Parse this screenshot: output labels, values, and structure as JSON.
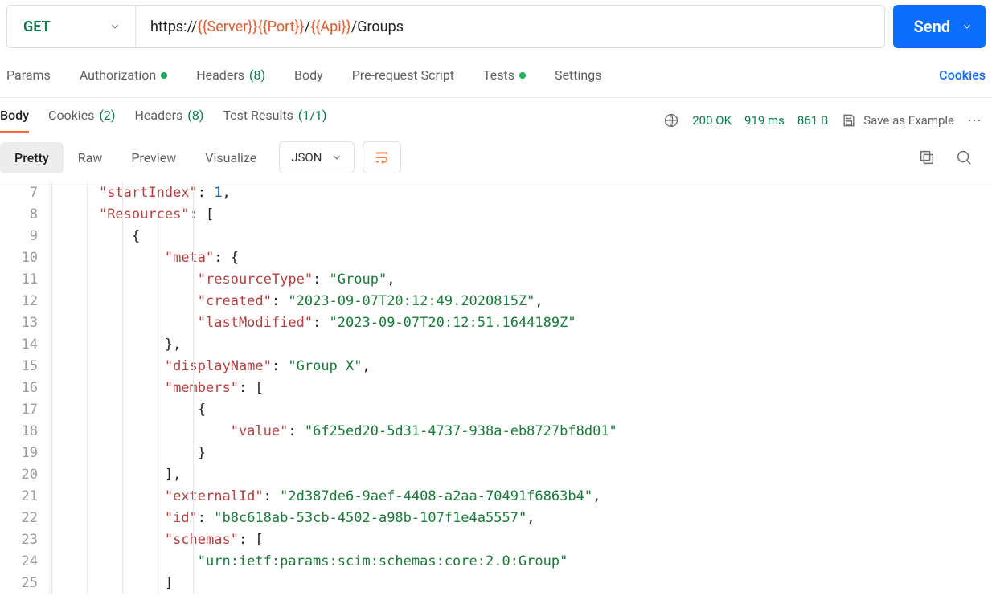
{
  "request": {
    "method": "GET",
    "url_prefix": "https://",
    "url_tmpl_server": "{{Server}}",
    "url_tmpl_port": "{{Port}}",
    "url_sep1": "/",
    "url_tmpl_api": "{{Api}}",
    "url_suffix": "/Groups",
    "send_label": "Send"
  },
  "req_tabs": {
    "params": "Params",
    "authorization": "Authorization",
    "headers": "Headers",
    "headers_count": "(8)",
    "body": "Body",
    "prerequest": "Pre-request Script",
    "tests": "Tests",
    "settings": "Settings",
    "cookies": "Cookies"
  },
  "resp_tabs": {
    "body": "Body",
    "cookies": "Cookies",
    "cookies_count": "(2)",
    "headers": "Headers",
    "headers_count": "(8)",
    "test_results": "Test Results",
    "test_results_count": "(1/1)"
  },
  "resp_meta": {
    "status": "200 OK",
    "time": "919 ms",
    "size": "861 B",
    "save_example": "Save as Example"
  },
  "view_tabs": {
    "pretty": "Pretty",
    "raw": "Raw",
    "preview": "Preview",
    "visualize": "Visualize",
    "format": "JSON"
  },
  "code": {
    "first_line_number": 7,
    "lines": [
      {
        "indent": 1,
        "tokens": [
          [
            "key",
            "\"startIndex\""
          ],
          [
            "punct",
            ": "
          ],
          [
            "num",
            "1"
          ],
          [
            "punct",
            ","
          ]
        ]
      },
      {
        "indent": 1,
        "tokens": [
          [
            "key",
            "\"Resources\""
          ],
          [
            "punct",
            ": ["
          ]
        ]
      },
      {
        "indent": 2,
        "tokens": [
          [
            "punct",
            "{"
          ]
        ]
      },
      {
        "indent": 3,
        "tokens": [
          [
            "key",
            "\"meta\""
          ],
          [
            "punct",
            ": {"
          ]
        ]
      },
      {
        "indent": 4,
        "tokens": [
          [
            "key",
            "\"resourceType\""
          ],
          [
            "punct",
            ": "
          ],
          [
            "str",
            "\"Group\""
          ],
          [
            "punct",
            ","
          ]
        ]
      },
      {
        "indent": 4,
        "tokens": [
          [
            "key",
            "\"created\""
          ],
          [
            "punct",
            ": "
          ],
          [
            "str",
            "\"2023-09-07T20:12:49.2020815Z\""
          ],
          [
            "punct",
            ","
          ]
        ]
      },
      {
        "indent": 4,
        "tokens": [
          [
            "key",
            "\"lastModified\""
          ],
          [
            "punct",
            ": "
          ],
          [
            "str",
            "\"2023-09-07T20:12:51.1644189Z\""
          ]
        ]
      },
      {
        "indent": 3,
        "tokens": [
          [
            "punct",
            "},"
          ]
        ]
      },
      {
        "indent": 3,
        "tokens": [
          [
            "key",
            "\"displayName\""
          ],
          [
            "punct",
            ": "
          ],
          [
            "str",
            "\"Group X\""
          ],
          [
            "punct",
            ","
          ]
        ]
      },
      {
        "indent": 3,
        "tokens": [
          [
            "key",
            "\"members\""
          ],
          [
            "punct",
            ": ["
          ]
        ]
      },
      {
        "indent": 4,
        "tokens": [
          [
            "punct",
            "{"
          ]
        ]
      },
      {
        "indent": 5,
        "tokens": [
          [
            "key",
            "\"value\""
          ],
          [
            "punct",
            ": "
          ],
          [
            "str",
            "\"6f25ed20-5d31-4737-938a-eb8727bf8d01\""
          ]
        ]
      },
      {
        "indent": 4,
        "tokens": [
          [
            "punct",
            "}"
          ]
        ]
      },
      {
        "indent": 3,
        "tokens": [
          [
            "punct",
            "],"
          ]
        ]
      },
      {
        "indent": 3,
        "tokens": [
          [
            "key",
            "\"externalId\""
          ],
          [
            "punct",
            ": "
          ],
          [
            "str",
            "\"2d387de6-9aef-4408-a2aa-70491f6863b4\""
          ],
          [
            "punct",
            ","
          ]
        ]
      },
      {
        "indent": 3,
        "tokens": [
          [
            "key",
            "\"id\""
          ],
          [
            "punct",
            ": "
          ],
          [
            "str",
            "\"b8c618ab-53cb-4502-a98b-107f1e4a5557\""
          ],
          [
            "punct",
            ","
          ]
        ]
      },
      {
        "indent": 3,
        "tokens": [
          [
            "key",
            "\"schemas\""
          ],
          [
            "punct",
            ": ["
          ]
        ]
      },
      {
        "indent": 4,
        "tokens": [
          [
            "str",
            "\"urn:ietf:params:scim:schemas:core:2.0:Group\""
          ]
        ]
      },
      {
        "indent": 3,
        "tokens": [
          [
            "punct",
            "]"
          ]
        ]
      }
    ]
  }
}
